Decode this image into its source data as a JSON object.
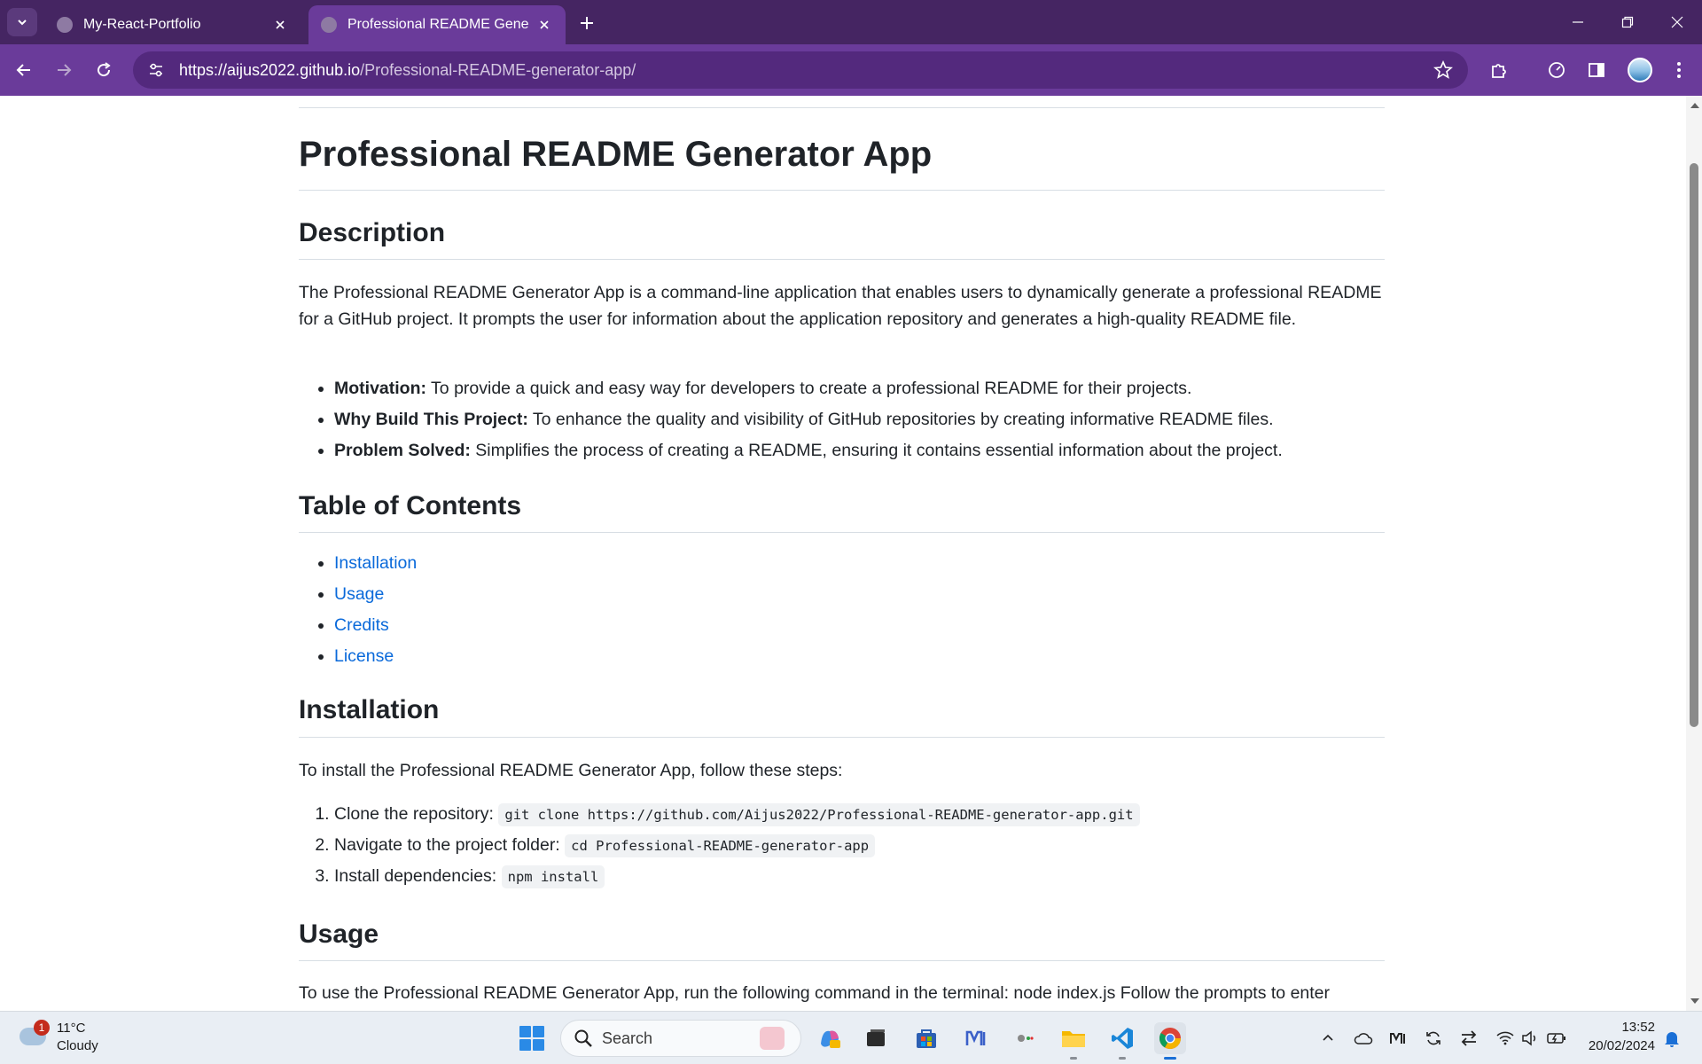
{
  "browser": {
    "tabs": [
      {
        "title": "My-React-Portfolio",
        "active": false
      },
      {
        "title": "Professional README Generator App",
        "active": true
      }
    ],
    "url_host": "https://aijus2022.github.io",
    "url_path": "/Professional-README-generator-app/"
  },
  "page": {
    "title": "Professional README Generator App",
    "description": {
      "heading": "Description",
      "text": "The Professional README Generator App is a command-line application that enables users to dynamically generate a professional README for a GitHub project. It prompts the user for information about the application repository and generates a high-quality README file.",
      "bullets": [
        {
          "label": "Motivation:",
          "text": " To provide a quick and easy way for developers to create a professional README for their projects."
        },
        {
          "label": "Why Build This Project:",
          "text": " To enhance the quality and visibility of GitHub repositories by creating informative README files."
        },
        {
          "label": "Problem Solved:",
          "text": " Simplifies the process of creating a README, ensuring it contains essential information about the project."
        }
      ]
    },
    "toc": {
      "heading": "Table of Contents",
      "items": [
        "Installation",
        "Usage",
        "Credits",
        "License"
      ]
    },
    "installation": {
      "heading": "Installation",
      "intro": "To install the Professional README Generator App, follow these steps:",
      "steps": [
        {
          "text": "Clone the repository: ",
          "code": "git clone https://github.com/Aijus2022/Professional-README-generator-app.git"
        },
        {
          "text": "Navigate to the project folder: ",
          "code": "cd Professional-README-generator-app"
        },
        {
          "text": "Install dependencies: ",
          "code": "npm install"
        }
      ]
    },
    "usage": {
      "heading": "Usage",
      "text": "To use the Professional README Generator App, run the following command in the terminal: node index.js Follow the prompts to enter"
    }
  },
  "taskbar": {
    "weather": {
      "temp": "11°C",
      "condition": "Cloudy",
      "badge": "1"
    },
    "search_label": "Search",
    "time": "13:52",
    "date": "20/02/2024"
  },
  "colors": {
    "tabstrip": "#452562",
    "toolbar": "#6a3b9a",
    "link": "#0969da",
    "text": "#1f2328"
  }
}
